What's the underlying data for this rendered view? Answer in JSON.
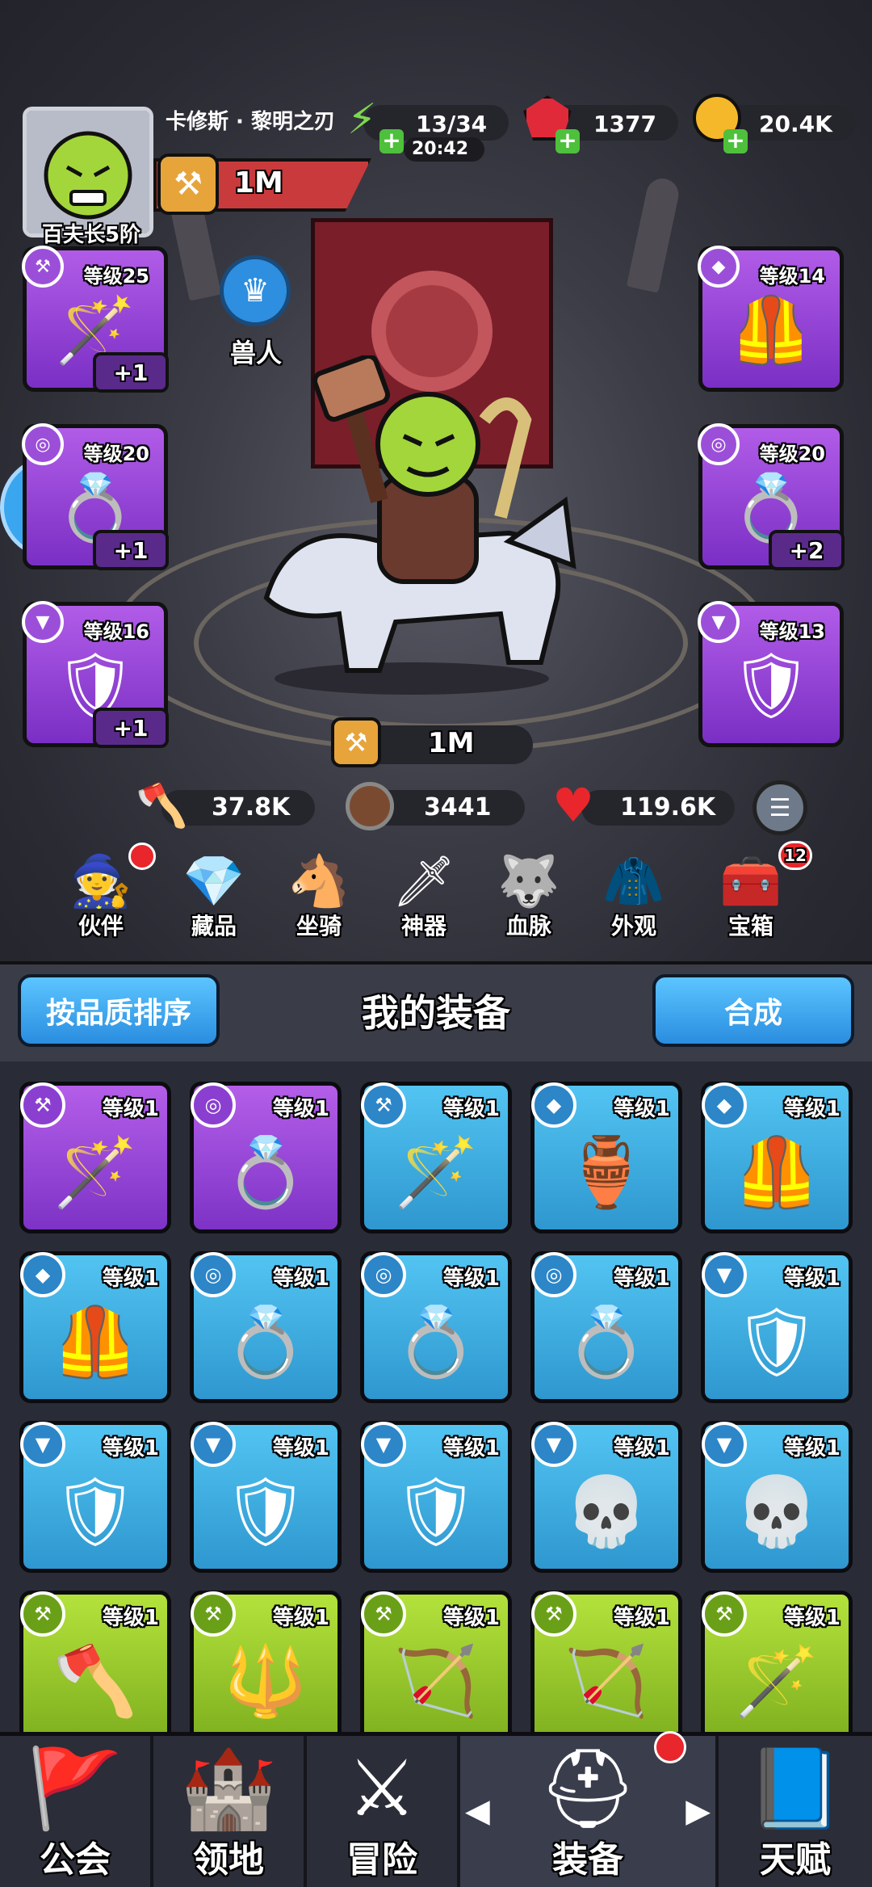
{
  "player": {
    "name": "卡修斯 · 黎明之刃",
    "rank": "百夫长5阶",
    "power": "1M"
  },
  "resources": {
    "energy": "13/34",
    "energy_timer": "20:42",
    "gems": "1377",
    "gold": "20.4K"
  },
  "race": "兽人",
  "equipped_left": [
    {
      "level": "等级25",
      "plus": "+1",
      "icon": "staff-icon"
    },
    {
      "level": "等级20",
      "plus": "+1",
      "icon": "ring-icon"
    },
    {
      "level": "等级16",
      "plus": "+1",
      "icon": "amulet-icon"
    }
  ],
  "equipped_right": [
    {
      "level": "等级14",
      "plus": "",
      "icon": "armor-icon"
    },
    {
      "level": "等级20",
      "plus": "+2",
      "icon": "ring-icon"
    },
    {
      "level": "等级13",
      "plus": "",
      "icon": "amulet-icon"
    }
  ],
  "combat_power": "1M",
  "stats": {
    "attack": "37.8K",
    "defense": "3441",
    "hp": "119.6K"
  },
  "feature_nav": [
    {
      "label": "伙伴",
      "icon": "hooded-companion-icon",
      "badge": "dot"
    },
    {
      "label": "藏品",
      "icon": "crystal-icon",
      "badge": ""
    },
    {
      "label": "坐骑",
      "icon": "horseshoe-icon",
      "badge": ""
    },
    {
      "label": "神器",
      "icon": "sword-icon",
      "badge": ""
    },
    {
      "label": "血脉",
      "icon": "beast-head-icon",
      "badge": ""
    },
    {
      "label": "外观",
      "icon": "cape-icon",
      "badge": ""
    },
    {
      "label": "宝箱",
      "icon": "chest-icon",
      "badge": "12"
    }
  ],
  "equipment_bar": {
    "sort_label": "按品质排序",
    "title": "我的装备",
    "merge_label": "合成"
  },
  "inventory": [
    {
      "rarity": "purple",
      "level": "等级1",
      "icon": "staff-icon",
      "type": "weapon"
    },
    {
      "rarity": "purple",
      "level": "等级1",
      "icon": "ring-icon",
      "type": "ring"
    },
    {
      "rarity": "blue",
      "level": "等级1",
      "icon": "staff-icon",
      "type": "weapon"
    },
    {
      "rarity": "blue",
      "level": "等级1",
      "icon": "chestplate-icon",
      "type": "armor"
    },
    {
      "rarity": "blue",
      "level": "等级1",
      "icon": "armor-icon",
      "type": "armor"
    },
    {
      "rarity": "blue",
      "level": "等级1",
      "icon": "armor-icon",
      "type": "armor"
    },
    {
      "rarity": "blue",
      "level": "等级1",
      "icon": "ring-icon",
      "type": "ring"
    },
    {
      "rarity": "blue",
      "level": "等级1",
      "icon": "ring-icon",
      "type": "ring"
    },
    {
      "rarity": "blue",
      "level": "等级1",
      "icon": "ring-icon",
      "type": "ring"
    },
    {
      "rarity": "blue",
      "level": "等级1",
      "icon": "amulet-icon",
      "type": "amulet"
    },
    {
      "rarity": "blue",
      "level": "等级1",
      "icon": "amulet-icon",
      "type": "amulet"
    },
    {
      "rarity": "blue",
      "level": "等级1",
      "icon": "amulet-icon",
      "type": "amulet"
    },
    {
      "rarity": "blue",
      "level": "等级1",
      "icon": "amulet-icon",
      "type": "amulet"
    },
    {
      "rarity": "blue",
      "level": "等级1",
      "icon": "skull-amulet-icon",
      "type": "amulet"
    },
    {
      "rarity": "blue",
      "level": "等级1",
      "icon": "skull-amulet-icon",
      "type": "amulet"
    },
    {
      "rarity": "green",
      "level": "等级1",
      "icon": "axe-icon",
      "type": "weapon"
    },
    {
      "rarity": "green",
      "level": "等级1",
      "icon": "spear-icon",
      "type": "weapon"
    },
    {
      "rarity": "green",
      "level": "等级1",
      "icon": "crossbow-icon",
      "type": "weapon"
    },
    {
      "rarity": "green",
      "level": "等级1",
      "icon": "bow-icon",
      "type": "weapon"
    },
    {
      "rarity": "green",
      "level": "等级1",
      "icon": "staff-icon",
      "type": "weapon"
    }
  ],
  "bottom_tabs": [
    {
      "label": "公会",
      "icon": "guild-banner-icon"
    },
    {
      "label": "领地",
      "icon": "castle-icon"
    },
    {
      "label": "冒险",
      "icon": "crossed-axes-icon"
    },
    {
      "label": "装备",
      "icon": "helmet-icon",
      "active": true,
      "badge": "dot"
    },
    {
      "label": "天赋",
      "icon": "spellbook-icon"
    }
  ],
  "colors": {
    "rarity_purple": "#9b4fd9",
    "rarity_blue": "#3aa8e0",
    "rarity_green": "#96c82a",
    "button_blue": "#3aa6f0",
    "badge_red": "#e8262c"
  }
}
